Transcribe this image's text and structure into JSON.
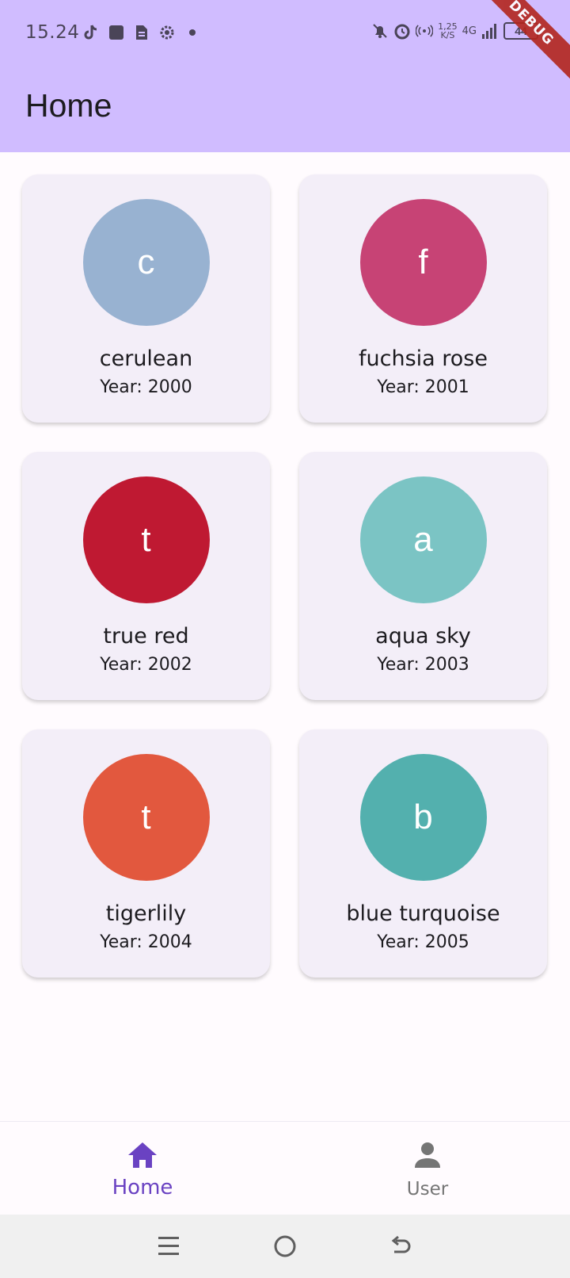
{
  "status_bar": {
    "time": "15.24",
    "net_speed_value": "1,25",
    "net_speed_unit": "K/S",
    "network_type": "4G",
    "battery": "44"
  },
  "debug_banner": "DEBUG",
  "app_bar": {
    "title": "Home"
  },
  "colors": [
    {
      "initial": "c",
      "name": "cerulean",
      "year": "Year: 2000",
      "hex": "#98B2D1"
    },
    {
      "initial": "f",
      "name": "fuchsia rose",
      "year": "Year: 2001",
      "hex": "#C74375"
    },
    {
      "initial": "t",
      "name": "true red",
      "year": "Year: 2002",
      "hex": "#BF1932"
    },
    {
      "initial": "a",
      "name": "aqua sky",
      "year": "Year: 2003",
      "hex": "#7BC4C4"
    },
    {
      "initial": "t",
      "name": "tigerlily",
      "year": "Year: 2004",
      "hex": "#E2583E"
    },
    {
      "initial": "b",
      "name": "blue turquoise",
      "year": "Year: 2005",
      "hex": "#53B0AE"
    }
  ],
  "bottom_nav": {
    "items": [
      {
        "label": "Home",
        "icon": "home-icon",
        "active": true
      },
      {
        "label": "User",
        "icon": "person-icon",
        "active": false
      }
    ]
  },
  "theme": {
    "app_bar_color": "#D0BCFF",
    "card_color": "#F3EEF8",
    "active_nav_color": "#6A42C2"
  }
}
